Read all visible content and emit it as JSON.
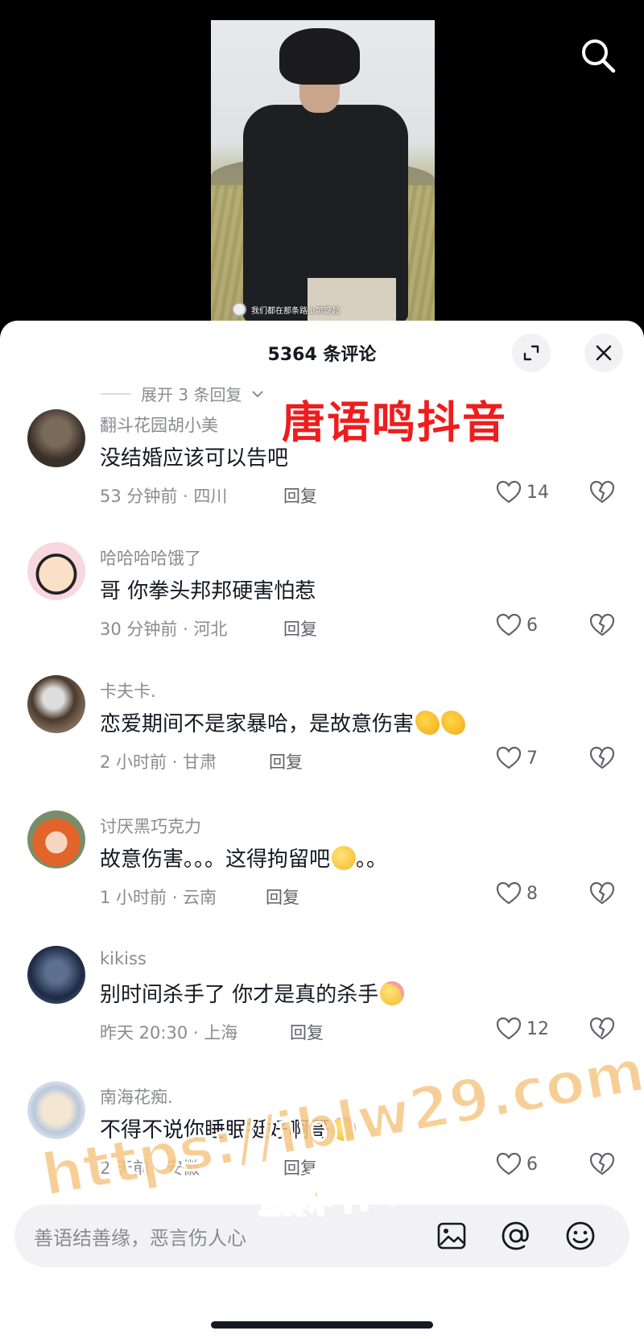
{
  "video": {
    "subtitle": "我们都在那条路上颠簸起"
  },
  "sheet": {
    "title": "5364 条评论",
    "expand_replies_label": "展开 3 条回复"
  },
  "overlay": {
    "red_watermark": "唐语鸣抖音",
    "site_watermark_line1": "https://iblw29.com",
    "site_watermark_line2": "黑料网"
  },
  "comments": [
    {
      "username": "翻斗花园胡小美",
      "content": "没结婚应该可以告吧",
      "emoji": "",
      "meta": "53 分钟前 · 四川",
      "reply": "回复",
      "likes": "14"
    },
    {
      "username": "哈哈哈哈饿了",
      "content": "哥 你拳头邦邦硬害怕惹",
      "emoji": "",
      "meta": "30 分钟前 · 河北",
      "reply": "回复",
      "likes": "6"
    },
    {
      "username": "卡夫卡.",
      "content": "恋爱期间不是家暴哈，是故意伤害",
      "emoji": "clap-clap",
      "meta": "2 小时前 · 甘肃",
      "reply": "回复",
      "likes": "7"
    },
    {
      "username": "讨厌黑巧克力",
      "content": "故意伤害。。。这得拘留吧",
      "content_after": "。。",
      "emoji": "dizzy",
      "meta": "1 小时前 · 云南",
      "reply": "回复",
      "likes": "8"
    },
    {
      "username": "kikiss",
      "content": "别时间杀手了 你才是真的杀手",
      "emoji": "blush",
      "meta": "昨天 20:30 · 上海",
      "reply": "回复",
      "likes": "12"
    },
    {
      "username": "南海花痴.",
      "content": "不得不说你睡眠挺好啊哥",
      "emoji": "blush",
      "meta": "2 天前 · 安徽",
      "reply": "回复",
      "likes": "6"
    }
  ],
  "input": {
    "placeholder": "善语结善缘，恶言伤人心"
  },
  "colors": {
    "text_primary": "#161823",
    "text_secondary": "#8a8b91",
    "watermark_red": "#ee1d1d",
    "watermark_site": "#f6c784"
  }
}
